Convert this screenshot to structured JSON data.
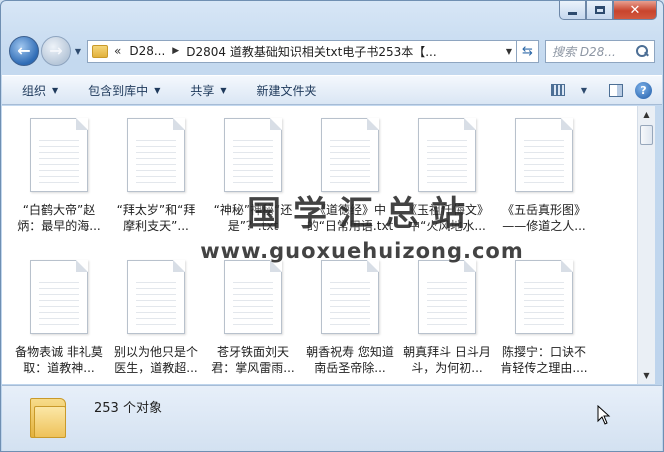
{
  "nav": {
    "address_chevrons": "«",
    "address_parts": [
      "D28...",
      "D2804 道教基础知识相关txt电子书253本【..."
    ],
    "search_placeholder": "搜索 D28..."
  },
  "toolbar": {
    "items": [
      "组织",
      "包含到库中",
      "共享",
      "新建文件夹"
    ]
  },
  "files": [
    "“白鹤大帝”赵炳：最早的海...",
    "“拜太岁”和“拜摩利支天”...",
    "“神秘”神秘“还是”？.txt",
    "《道德经》中的“日常用语.txt",
    "《玉祖仟悔文》中“火风地水...",
    "《五岳真形图》——修道之人...",
    "备物表诚 非礼莫取：道教神...",
    "别以为他只是个医生，道教超...",
    "苍牙铁面刘天君：掌风雷雨...",
    "朝香祝寿 您知道南岳圣帝除...",
    "朝真拜斗 日斗月斗，为何初...",
    "陈撄宁：口诀不肯轻传之理由...."
  ],
  "watermark": {
    "title": "国学汇总站",
    "url": "www.guoxuehuizong.com"
  },
  "status": {
    "count_text": "253 个对象"
  },
  "colors": {
    "accent": "#2e6bb5",
    "close_button": "#c8442d",
    "folder": "#e3b13d"
  }
}
